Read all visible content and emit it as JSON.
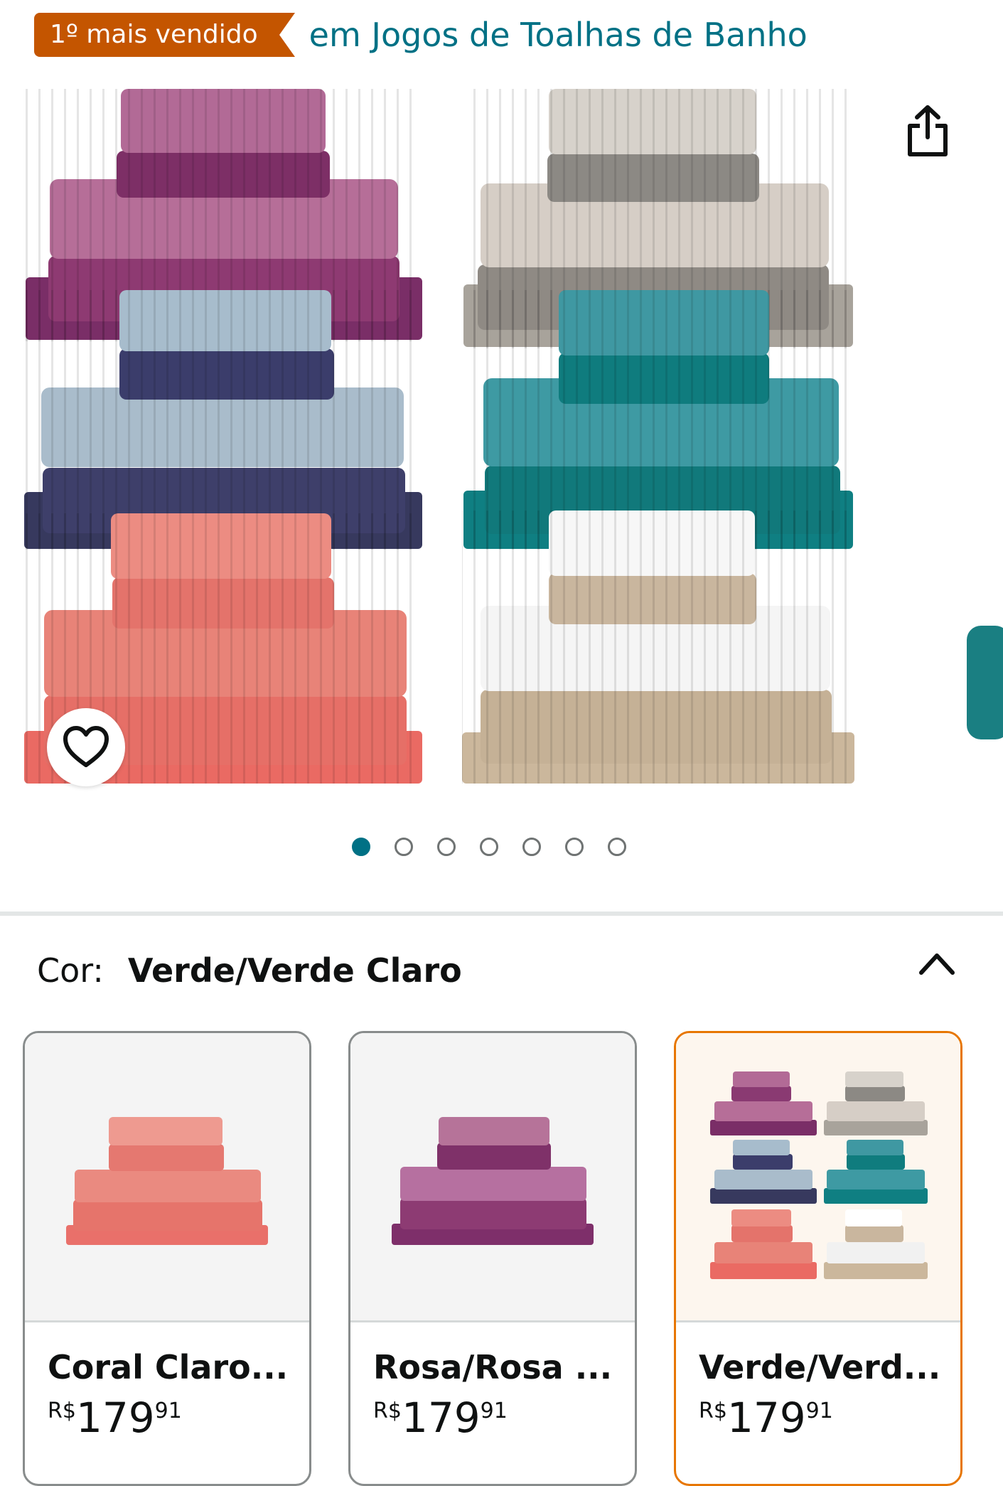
{
  "badge": {
    "label": "1º mais vendido",
    "category": "em Jogos de Toalhas de Banho"
  },
  "gallery": {
    "dot_count": 7,
    "active_index": 0
  },
  "color": {
    "label": "Cor:",
    "selected": "Verde/Verde Claro"
  },
  "swatches": [
    {
      "name": "Coral Claro...",
      "currency": "R$",
      "whole": "179",
      "fraction": "91"
    },
    {
      "name": "Rosa/Rosa ...",
      "currency": "R$",
      "whole": "179",
      "fraction": "91"
    },
    {
      "name": "Verde/Verd...",
      "currency": "R$",
      "whole": "179",
      "fraction": "91"
    }
  ],
  "colors": {
    "accent": "#007185",
    "badge": "#c45500",
    "selected_border": "#e77600"
  },
  "icons": [
    "share-icon",
    "heart-icon",
    "chevron-up-icon"
  ]
}
